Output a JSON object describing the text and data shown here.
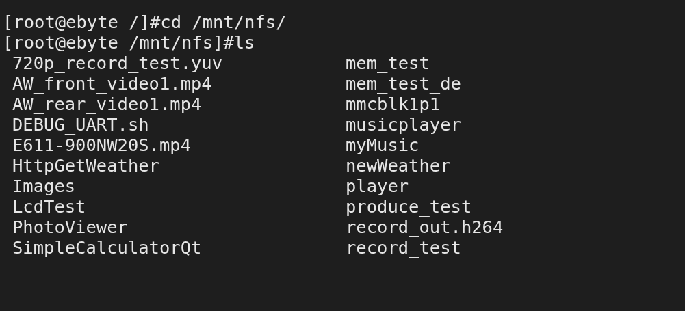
{
  "terminal": {
    "prompt_lines": [
      "[root@ebyte /]#cd /mnt/nfs/",
      "[root@ebyte /mnt/nfs]#ls"
    ],
    "listing": [
      [
        "720p_record_test.yuv",
        "mem_test"
      ],
      [
        "AW_front_video1.mp4",
        "mem_test_de"
      ],
      [
        "AW_rear_video1.mp4",
        "mmcblk1p1"
      ],
      [
        "DEBUG_UART.sh",
        "musicplayer"
      ],
      [
        "E611-900NW20S.mp4",
        "myMusic"
      ],
      [
        "HttpGetWeather",
        "newWeather"
      ],
      [
        "Images",
        "player"
      ],
      [
        "LcdTest",
        "produce_test"
      ],
      [
        "PhotoViewer",
        "record_out.h264"
      ],
      [
        "SimpleCalculatorQt",
        "record_test"
      ]
    ]
  }
}
